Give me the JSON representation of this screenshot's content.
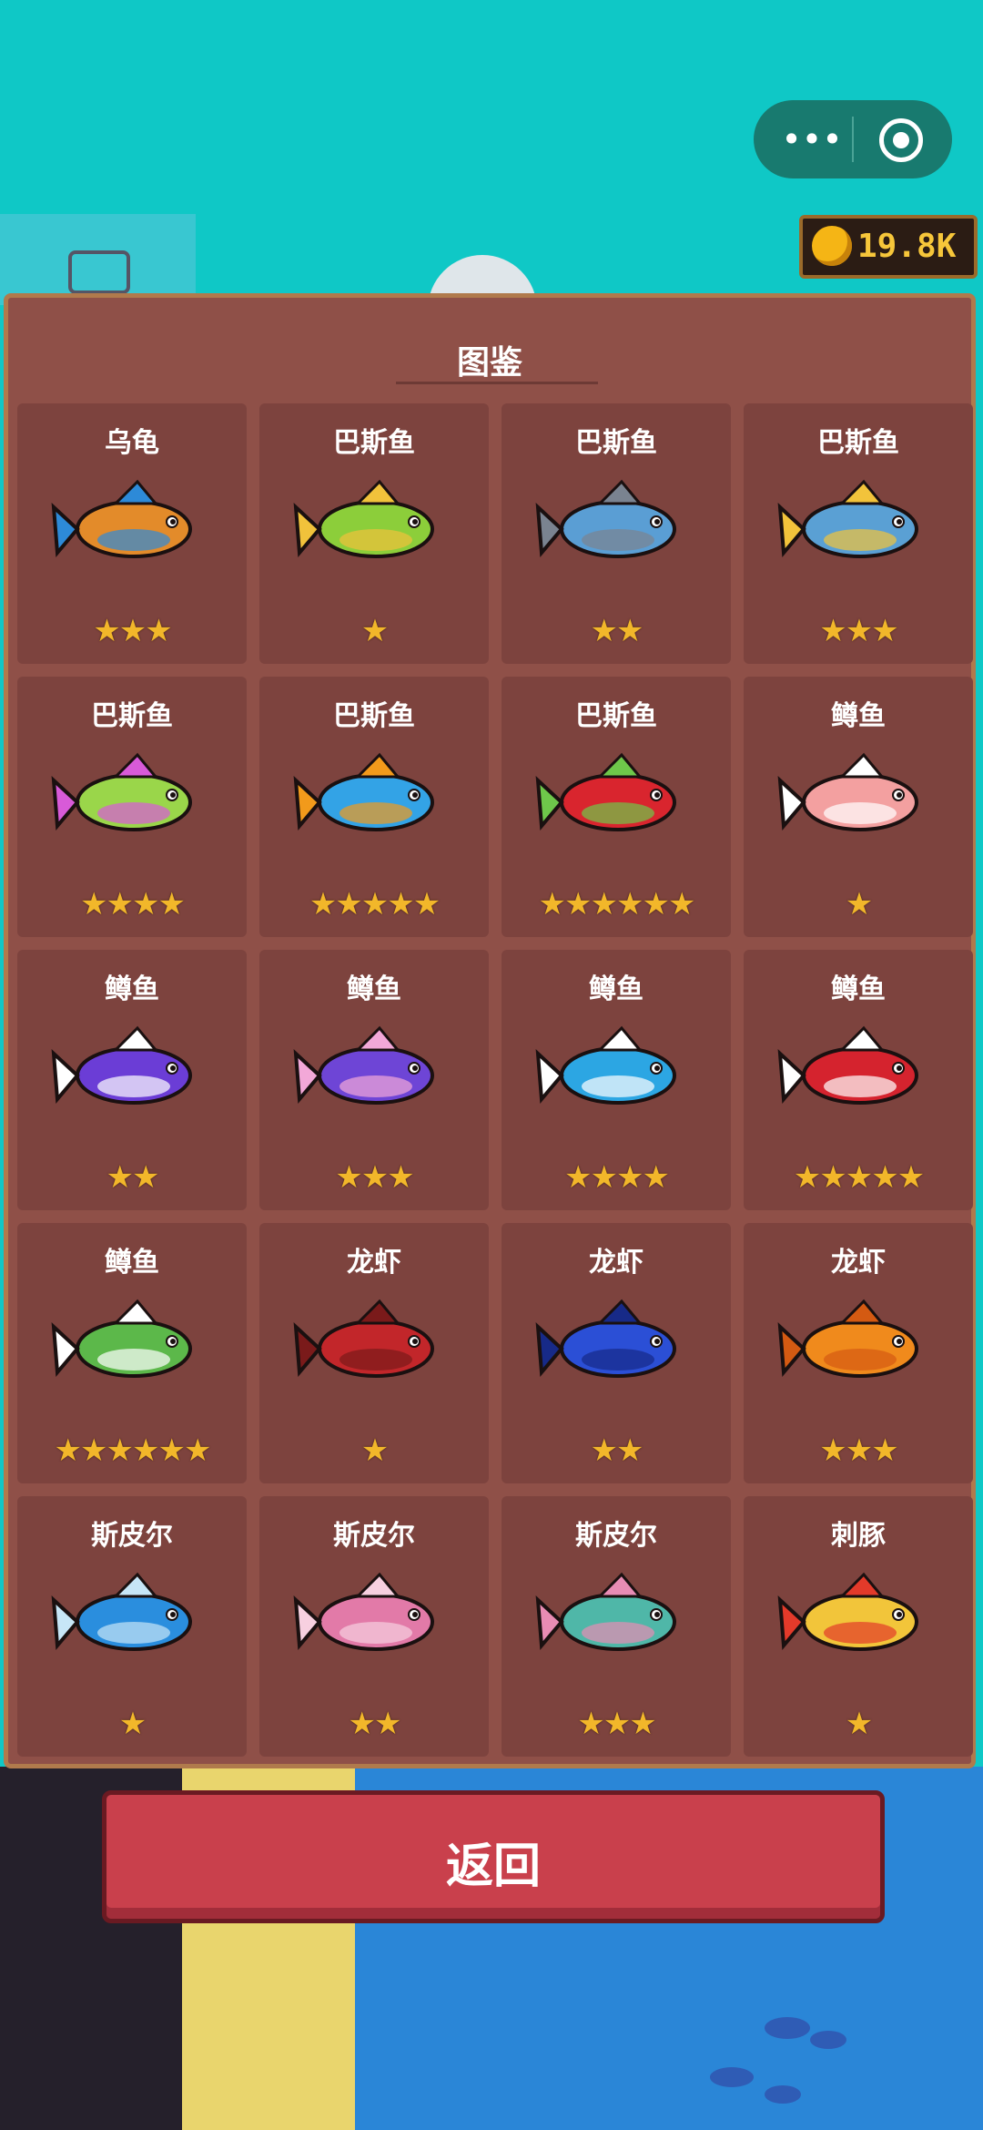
{
  "top_bar": {
    "more_glyph": "•••",
    "close_icon": "target-icon"
  },
  "currency": {
    "value": "19.8K",
    "icon": "coin-icon"
  },
  "panel": {
    "title": "图鉴",
    "entries": [
      {
        "name": "乌龟",
        "stars": "★★★",
        "art_colors": [
          "#e38b2a",
          "#2d8ad8"
        ]
      },
      {
        "name": "巴斯鱼",
        "stars": "★",
        "art_colors": [
          "#8cce3a",
          "#f1c23b"
        ]
      },
      {
        "name": "巴斯鱼",
        "stars": "★★",
        "art_colors": [
          "#5a9ed4",
          "#7a8390"
        ]
      },
      {
        "name": "巴斯鱼",
        "stars": "★★★",
        "art_colors": [
          "#5aa0d4",
          "#f2c33b"
        ]
      },
      {
        "name": "巴斯鱼",
        "stars": "★★★★",
        "art_colors": [
          "#9ad64a",
          "#d85ad8"
        ]
      },
      {
        "name": "巴斯鱼",
        "stars": "★★★★★",
        "art_colors": [
          "#33a3e6",
          "#f29a1b"
        ]
      },
      {
        "name": "巴斯鱼",
        "stars": "★★★★★★",
        "art_colors": [
          "#d9252e",
          "#6ec74a"
        ]
      },
      {
        "name": "鳟鱼",
        "stars": "★",
        "art_colors": [
          "#f3a0a0",
          "#ffffff"
        ]
      },
      {
        "name": "鳟鱼",
        "stars": "★★",
        "art_colors": [
          "#6b3dd6",
          "#ffffff"
        ]
      },
      {
        "name": "鳟鱼",
        "stars": "★★★",
        "art_colors": [
          "#6e45d6",
          "#f2a8d8"
        ]
      },
      {
        "name": "鳟鱼",
        "stars": "★★★★",
        "art_colors": [
          "#2ca6e3",
          "#ffffff"
        ]
      },
      {
        "name": "鳟鱼",
        "stars": "★★★★★",
        "art_colors": [
          "#d5232e",
          "#ffffff"
        ]
      },
      {
        "name": "鳟鱼",
        "stars": "★★★★★★",
        "art_colors": [
          "#5cb84a",
          "#ffffff"
        ]
      },
      {
        "name": "龙虾",
        "stars": "★",
        "art_colors": [
          "#c2262a",
          "#7a1a1a"
        ]
      },
      {
        "name": "龙虾",
        "stars": "★★",
        "art_colors": [
          "#2b4fd6",
          "#172a88"
        ]
      },
      {
        "name": "龙虾",
        "stars": "★★★",
        "art_colors": [
          "#f08a1c",
          "#d45a12"
        ]
      },
      {
        "name": "斯皮尔",
        "stars": "★",
        "art_colors": [
          "#2a8ede",
          "#c7e6f7"
        ]
      },
      {
        "name": "斯皮尔",
        "stars": "★★",
        "art_colors": [
          "#e27aa8",
          "#f7d0e0"
        ]
      },
      {
        "name": "斯皮尔",
        "stars": "★★★",
        "art_colors": [
          "#4fb7a8",
          "#e88cb4"
        ]
      },
      {
        "name": "刺豚",
        "stars": "★",
        "art_colors": [
          "#f2c53a",
          "#e33a2a"
        ]
      }
    ]
  },
  "footer": {
    "return_label": "返回"
  }
}
